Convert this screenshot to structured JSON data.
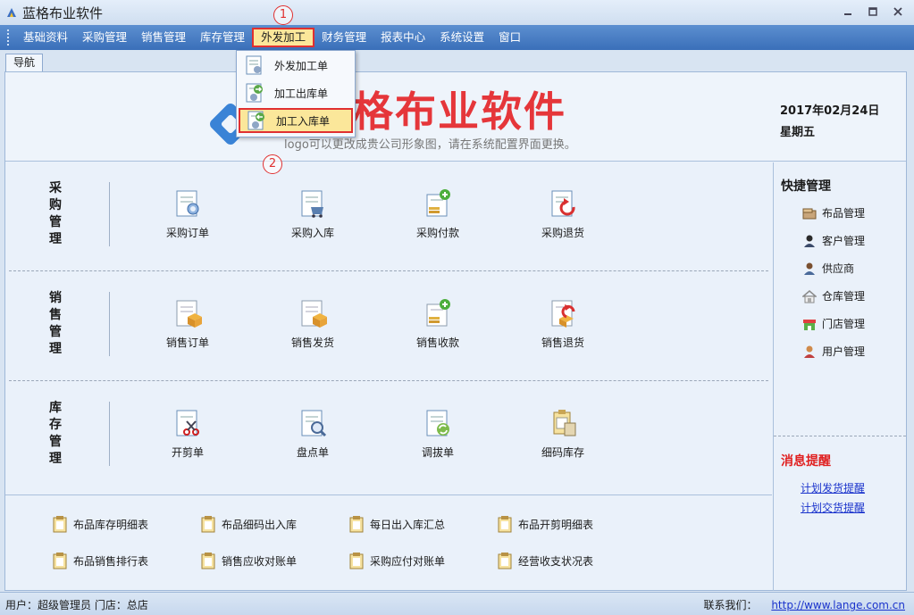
{
  "window": {
    "title": "蓝格布业软件"
  },
  "menu": [
    {
      "label": "基础资料"
    },
    {
      "label": "采购管理"
    },
    {
      "label": "销售管理"
    },
    {
      "label": "库存管理"
    },
    {
      "label": "外发加工"
    },
    {
      "label": "财务管理"
    },
    {
      "label": "报表中心"
    },
    {
      "label": "系统设置"
    },
    {
      "label": "窗口"
    }
  ],
  "dropdown": {
    "items": [
      {
        "label": "外发加工单"
      },
      {
        "label": "加工出库单"
      },
      {
        "label": "加工入库单"
      }
    ]
  },
  "annotations": {
    "marker1": "1",
    "marker2": "2"
  },
  "tab": {
    "label": "导航"
  },
  "banner": {
    "logo_text": "格布业软件",
    "logo_sub": "logo可以更改成贵公司形象图，请在系统配置界面更换。",
    "date": "2017年02月24日",
    "weekday": "星期五"
  },
  "modules": [
    {
      "label": "采购管理",
      "buttons": [
        {
          "label": "采购订单",
          "icon": "purchase-order-icon"
        },
        {
          "label": "采购入库",
          "icon": "purchase-in-icon"
        },
        {
          "label": "采购付款",
          "icon": "purchase-payment-icon"
        },
        {
          "label": "采购退货",
          "icon": "purchase-return-icon"
        }
      ]
    },
    {
      "label": "销售管理",
      "buttons": [
        {
          "label": "销售订单",
          "icon": "sales-order-icon"
        },
        {
          "label": "销售发货",
          "icon": "sales-ship-icon"
        },
        {
          "label": "销售收款",
          "icon": "sales-receipt-icon"
        },
        {
          "label": "销售退货",
          "icon": "sales-return-icon"
        }
      ]
    },
    {
      "label": "库存管理",
      "buttons": [
        {
          "label": "开剪单",
          "icon": "cutting-icon"
        },
        {
          "label": "盘点单",
          "icon": "stocktake-icon"
        },
        {
          "label": "调拔单",
          "icon": "transfer-icon"
        },
        {
          "label": "细码库存",
          "icon": "detail-stock-icon"
        }
      ]
    }
  ],
  "reports": [
    {
      "label": "布品库存明细表"
    },
    {
      "label": "布品细码出入库"
    },
    {
      "label": "每日出入库汇总"
    },
    {
      "label": "布品开剪明细表"
    },
    {
      "label": "布品销售排行表"
    },
    {
      "label": "销售应收对账单"
    },
    {
      "label": "采购应付对账单"
    },
    {
      "label": "经营收支状况表"
    }
  ],
  "quick": {
    "title": "快捷管理",
    "items": [
      {
        "label": "布品管理",
        "icon": "fabric-icon"
      },
      {
        "label": "客户管理",
        "icon": "customer-icon"
      },
      {
        "label": "供应商",
        "icon": "supplier-icon"
      },
      {
        "label": "仓库管理",
        "icon": "warehouse-icon"
      },
      {
        "label": "门店管理",
        "icon": "store-icon"
      },
      {
        "label": "用户管理",
        "icon": "user-icon"
      }
    ]
  },
  "messages": {
    "title": "消息提醒",
    "links": [
      {
        "label": "计划发货提醒"
      },
      {
        "label": "计划交货提醒"
      }
    ]
  },
  "status": {
    "user_store": "用户：超级管理员  门店：总店",
    "contact_label": "联系我们：",
    "contact_url": "http://www.lange.com.cn"
  },
  "colors": {
    "menubar": "#3a6fb9",
    "highlight": "#fbe79a",
    "annotation_red": "#e03030",
    "logo_red": "#e5363a",
    "link_blue": "#1a33cc"
  }
}
